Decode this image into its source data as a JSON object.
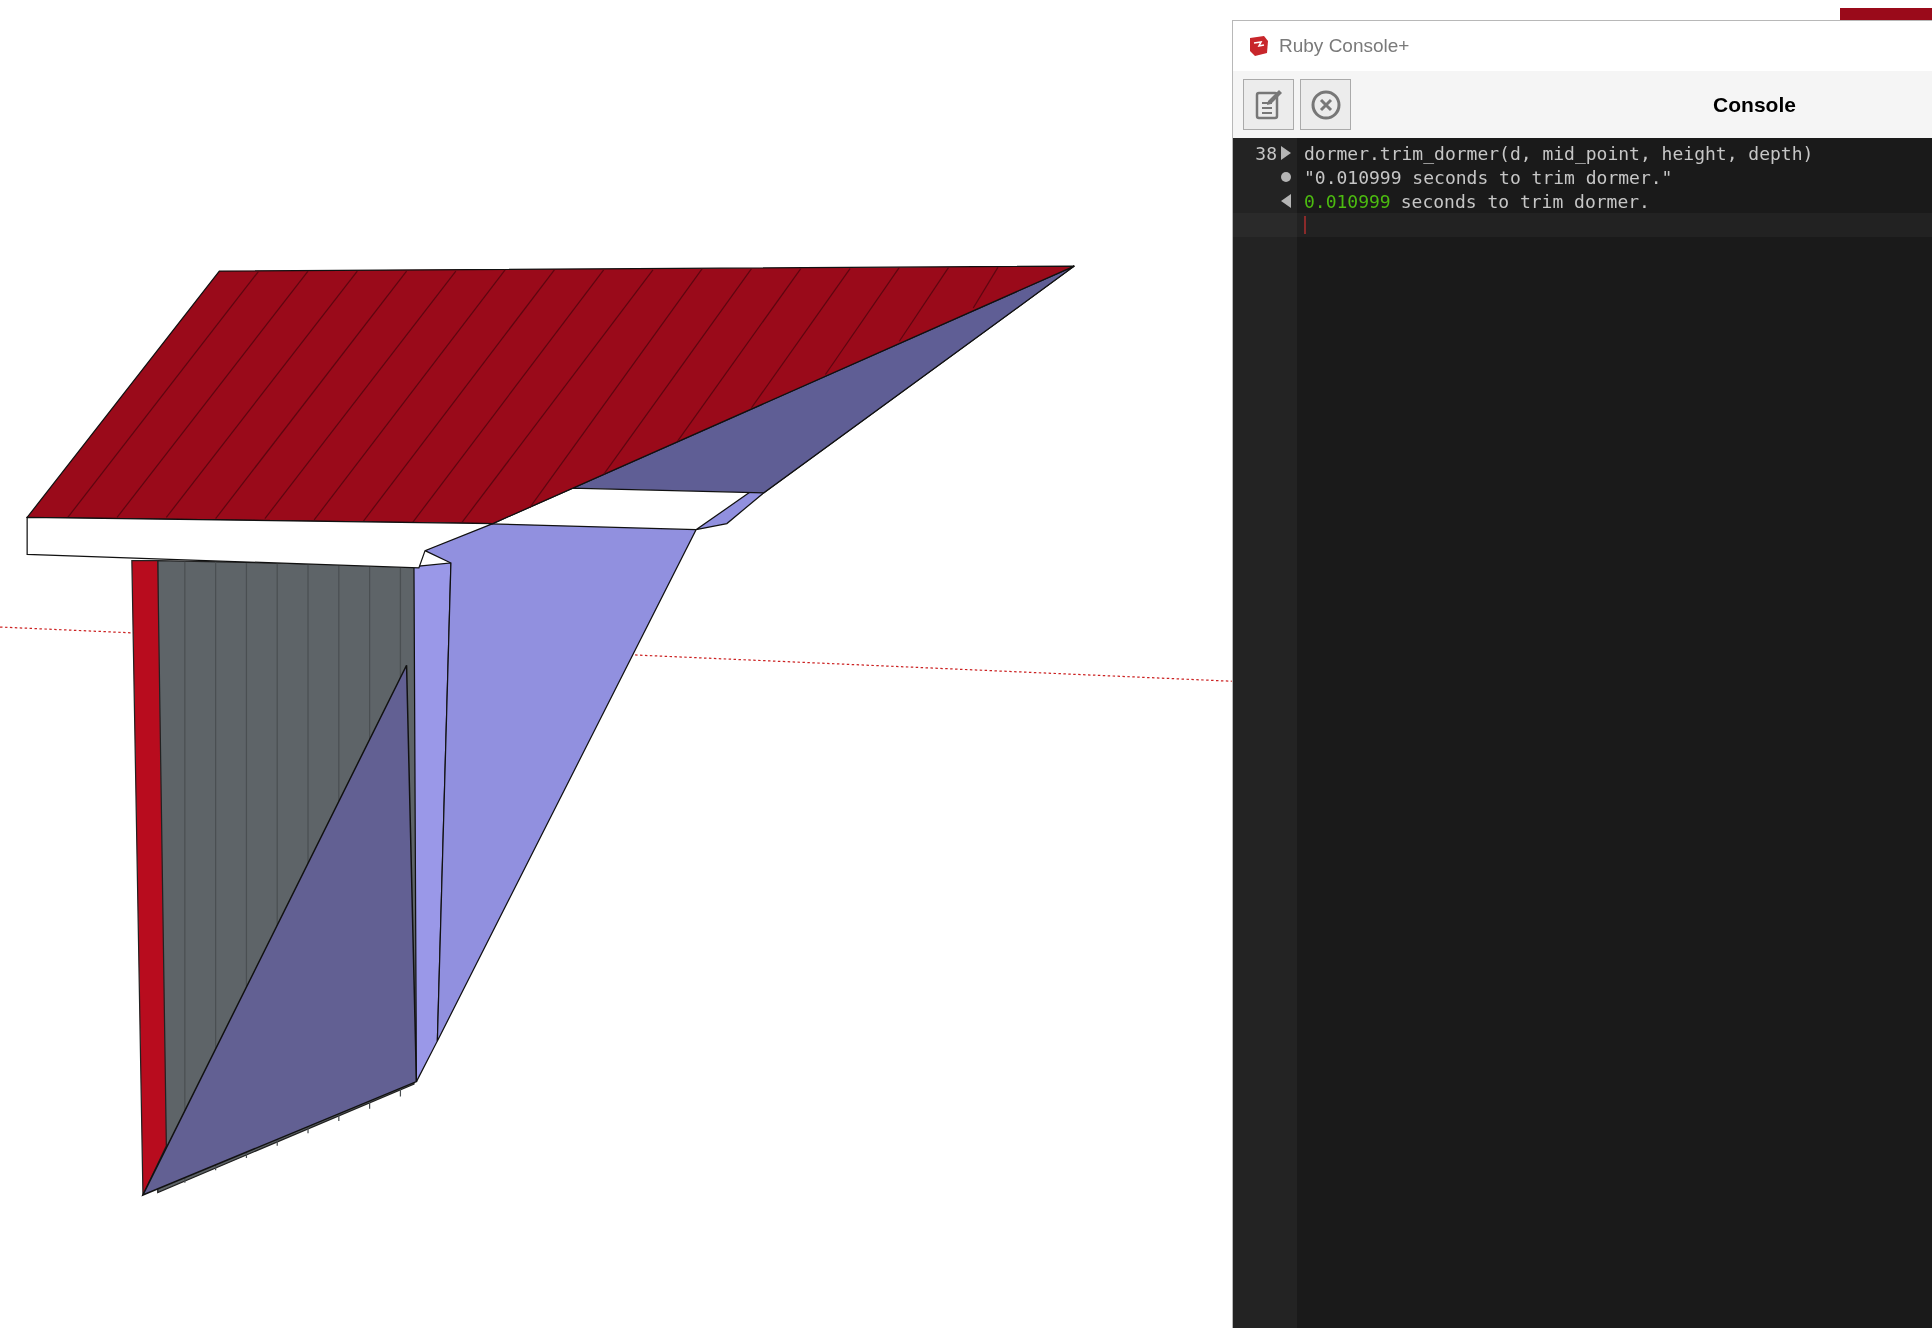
{
  "window": {
    "title": "Ruby Console+"
  },
  "toolbar": {
    "heading": "Console"
  },
  "console": {
    "lines": [
      {
        "kind": "input",
        "number": "38",
        "text": "dormer.trim_dormer(d, mid_point, height, depth)"
      },
      {
        "kind": "output",
        "text": "\"0.010999 seconds to trim dormer.\""
      },
      {
        "kind": "result",
        "value": "0.010999",
        "text": "seconds to trim dormer."
      }
    ]
  }
}
